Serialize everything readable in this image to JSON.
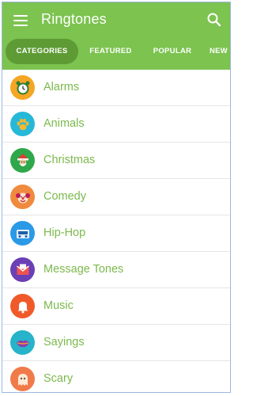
{
  "app_title": "Ringtones",
  "colors": {
    "appbar": "#7cc34f",
    "active_tab": "#5e9b35",
    "label": "#7cb94d"
  },
  "tabs": [
    {
      "label": "CATEGORIES",
      "active": true
    },
    {
      "label": "FEATURED",
      "active": false
    },
    {
      "label": "POPULAR",
      "active": false
    },
    {
      "label": "NEW",
      "active": false
    }
  ],
  "categories": [
    {
      "label": "Alarms",
      "icon": "alarm-clock-icon",
      "color": "#f5a623"
    },
    {
      "label": "Animals",
      "icon": "paw-icon",
      "color": "#26b8d8"
    },
    {
      "label": "Christmas",
      "icon": "santa-icon",
      "color": "#2ea84a"
    },
    {
      "label": "Comedy",
      "icon": "clown-icon",
      "color": "#f08a3e"
    },
    {
      "label": "Hip-Hop",
      "icon": "boombox-icon",
      "color": "#2a9ae6"
    },
    {
      "label": "Message Tones",
      "icon": "envelope-icon",
      "color": "#6b3fb5"
    },
    {
      "label": "Music",
      "icon": "bell-icon",
      "color": "#f05a2a"
    },
    {
      "label": "Sayings",
      "icon": "lips-icon",
      "color": "#27b3c9"
    },
    {
      "label": "Scary",
      "icon": "ghost-icon",
      "color": "#f07a4a"
    }
  ]
}
